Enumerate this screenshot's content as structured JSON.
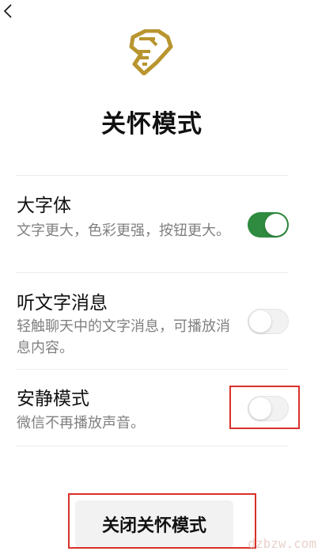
{
  "header": {
    "back_icon": "chevron-left-icon",
    "logo_icon": "care-hand-heart-logo",
    "logo_color": "#b8952f",
    "title": "关怀模式"
  },
  "settings": [
    {
      "title": "大字体",
      "description": "文字更大，色彩更强，按钮更大。",
      "enabled": true
    },
    {
      "title": "听文字消息",
      "description": "轻触聊天中的文字消息，可播放消息内容。",
      "enabled": false
    },
    {
      "title": "安静模式",
      "description": "微信不再播放声音。",
      "enabled": false
    }
  ],
  "close_button": {
    "label": "关闭关怀模式"
  },
  "colors": {
    "toggle_on": "#2e8b3f",
    "annotation_red": "#d9302a"
  },
  "watermark": {
    "text": "dzbzw.com"
  }
}
